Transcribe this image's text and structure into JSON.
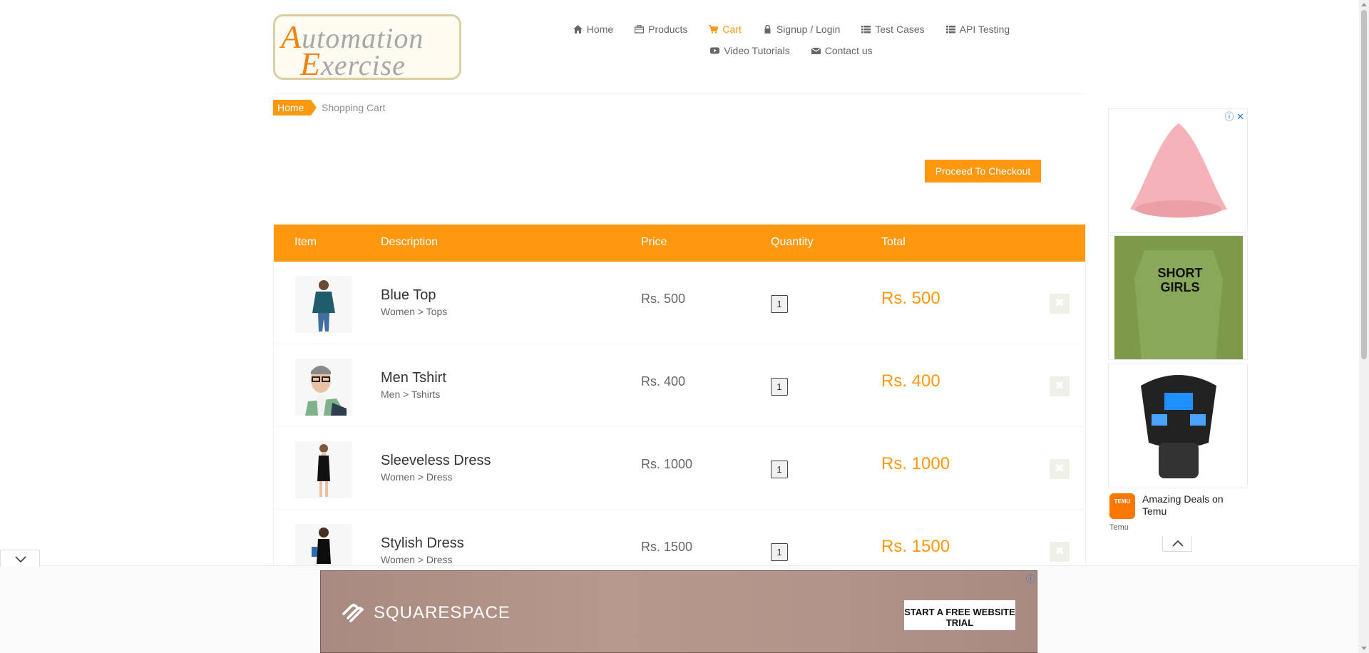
{
  "logo": {
    "line1_first": "A",
    "line1_rest": "utomation",
    "line2_first": "E",
    "line2_rest": "xercise"
  },
  "nav": {
    "row1": [
      {
        "label": "Home",
        "icon": "home-icon",
        "active": false
      },
      {
        "label": "Products",
        "icon": "briefcase-icon",
        "active": false
      },
      {
        "label": "Cart",
        "icon": "cart-icon",
        "active": true
      },
      {
        "label": "Signup / Login",
        "icon": "lock-icon",
        "active": false
      },
      {
        "label": "Test Cases",
        "icon": "list-icon",
        "active": false
      },
      {
        "label": "API Testing",
        "icon": "list-icon",
        "active": false
      }
    ],
    "row2": [
      {
        "label": "Video Tutorials",
        "icon": "youtube-icon",
        "active": false
      },
      {
        "label": "Contact us",
        "icon": "envelope-icon",
        "active": false
      }
    ]
  },
  "breadcrumb": {
    "home": "Home",
    "current": "Shopping Cart"
  },
  "checkout_label": "Proceed To Checkout",
  "table": {
    "headers": [
      "Item",
      "Description",
      "Price",
      "Quantity",
      "Total"
    ],
    "rows": [
      {
        "name": "Blue Top",
        "category": "Women > Tops",
        "price": "Rs. 500",
        "quantity": "1",
        "total": "Rs. 500"
      },
      {
        "name": "Men Tshirt",
        "category": "Men > Tshirts",
        "price": "Rs. 400",
        "quantity": "1",
        "total": "Rs. 400"
      },
      {
        "name": "Sleeveless Dress",
        "category": "Women > Dress",
        "price": "Rs. 1000",
        "quantity": "1",
        "total": "Rs. 1000"
      },
      {
        "name": "Stylish Dress",
        "category": "Women > Dress",
        "price": "Rs. 1500",
        "quantity": "1",
        "total": "Rs. 1500"
      }
    ],
    "delete_glyph": "✖"
  },
  "side_ad": {
    "info_glyph": "ⓘ",
    "close_glyph": "✕",
    "tshirt_text": "SHORT GIRLS",
    "logo_text": "TEMU",
    "caption": "Amazing Deals on Temu",
    "source": "Temu"
  },
  "banner": {
    "brand": "SQUARESPACE",
    "cta": "START A FREE WEBSITE TRIAL",
    "info_glyph": "ⓘ"
  },
  "colors": {
    "accent": "#fe980f",
    "text": "#696763",
    "delete_bg": "#f0f0e9"
  }
}
